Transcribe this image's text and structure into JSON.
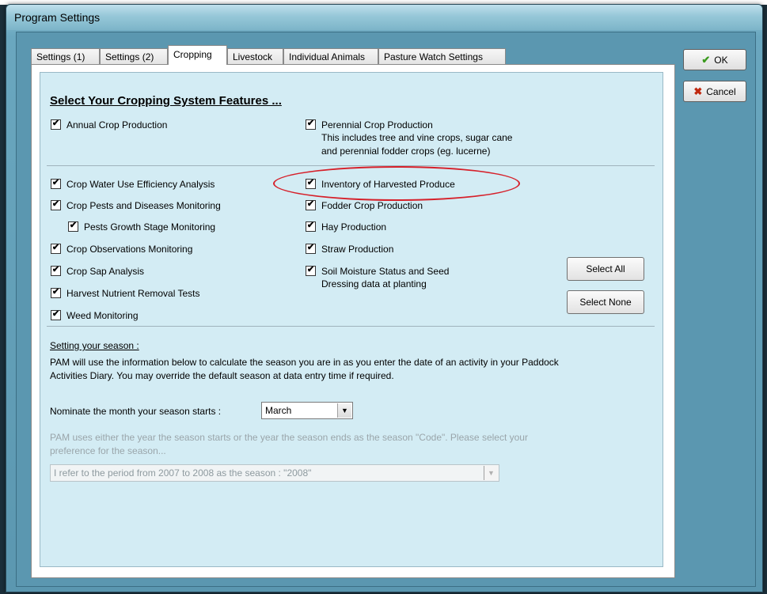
{
  "window": {
    "title": "Program Settings"
  },
  "tabs": [
    {
      "label": "Settings (1)",
      "active": false
    },
    {
      "label": "Settings (2)",
      "active": false
    },
    {
      "label": "Cropping",
      "active": true
    },
    {
      "label": "Livestock",
      "active": false
    },
    {
      "label": "Individual Animals",
      "active": false
    },
    {
      "label": "Pasture Watch Settings",
      "active": false
    }
  ],
  "cropping": {
    "heading": "Select Your Cropping System Features ...",
    "annual": {
      "label": "Annual  Crop Production",
      "checked": true
    },
    "perennial": {
      "label": "Perennial Crop Production",
      "desc1": "This includes tree and vine crops, sugar cane",
      "desc2": "and perennial fodder crops (eg. lucerne)",
      "checked": true
    },
    "left_options": [
      {
        "label": "Crop Water Use Efficiency Analysis",
        "checked": true
      },
      {
        "label": "Crop Pests and Diseases Monitoring",
        "checked": true
      },
      {
        "label": "Pests Growth Stage Monitoring",
        "checked": true
      },
      {
        "label": "Crop Observations Monitoring",
        "checked": true
      },
      {
        "label": "Crop Sap Analysis",
        "checked": true
      },
      {
        "label": "Harvest Nutrient Removal Tests",
        "checked": true
      },
      {
        "label": "Weed Monitoring",
        "checked": true
      }
    ],
    "right_options": [
      {
        "label": "Inventory of Harvested Produce",
        "checked": true
      },
      {
        "label": "Fodder Crop Production",
        "checked": true
      },
      {
        "label": "Hay Production",
        "checked": true
      },
      {
        "label": "Straw Production",
        "checked": true
      }
    ],
    "soil": {
      "line1": "Soil Moisture Status and Seed",
      "line2": "Dressing data at planting",
      "checked": true
    },
    "select_all_label": "Select All",
    "select_none_label": "Select None"
  },
  "season": {
    "heading": "Setting your season :",
    "info1": "PAM will use the information below to calculate the season you are in as you enter the date of an activity in your Paddock",
    "info2": "Activities Diary.  You may override the default season at data entry time if required.",
    "month_label": "Nominate the month your season starts :",
    "month_value": "March",
    "code_info1": "PAM uses either the year the season starts or the year the season ends as the season \"Code\".  Please select your",
    "code_info2": "preference for the season...",
    "code_value": "I refer to the period from  2007 to  2008 as the season : \"2008\""
  },
  "buttons": {
    "ok": "OK",
    "cancel": "Cancel"
  },
  "colors": {
    "highlight": "#d6202a",
    "ok_icon": "#3a9a1e",
    "cancel_icon": "#c0280f"
  }
}
